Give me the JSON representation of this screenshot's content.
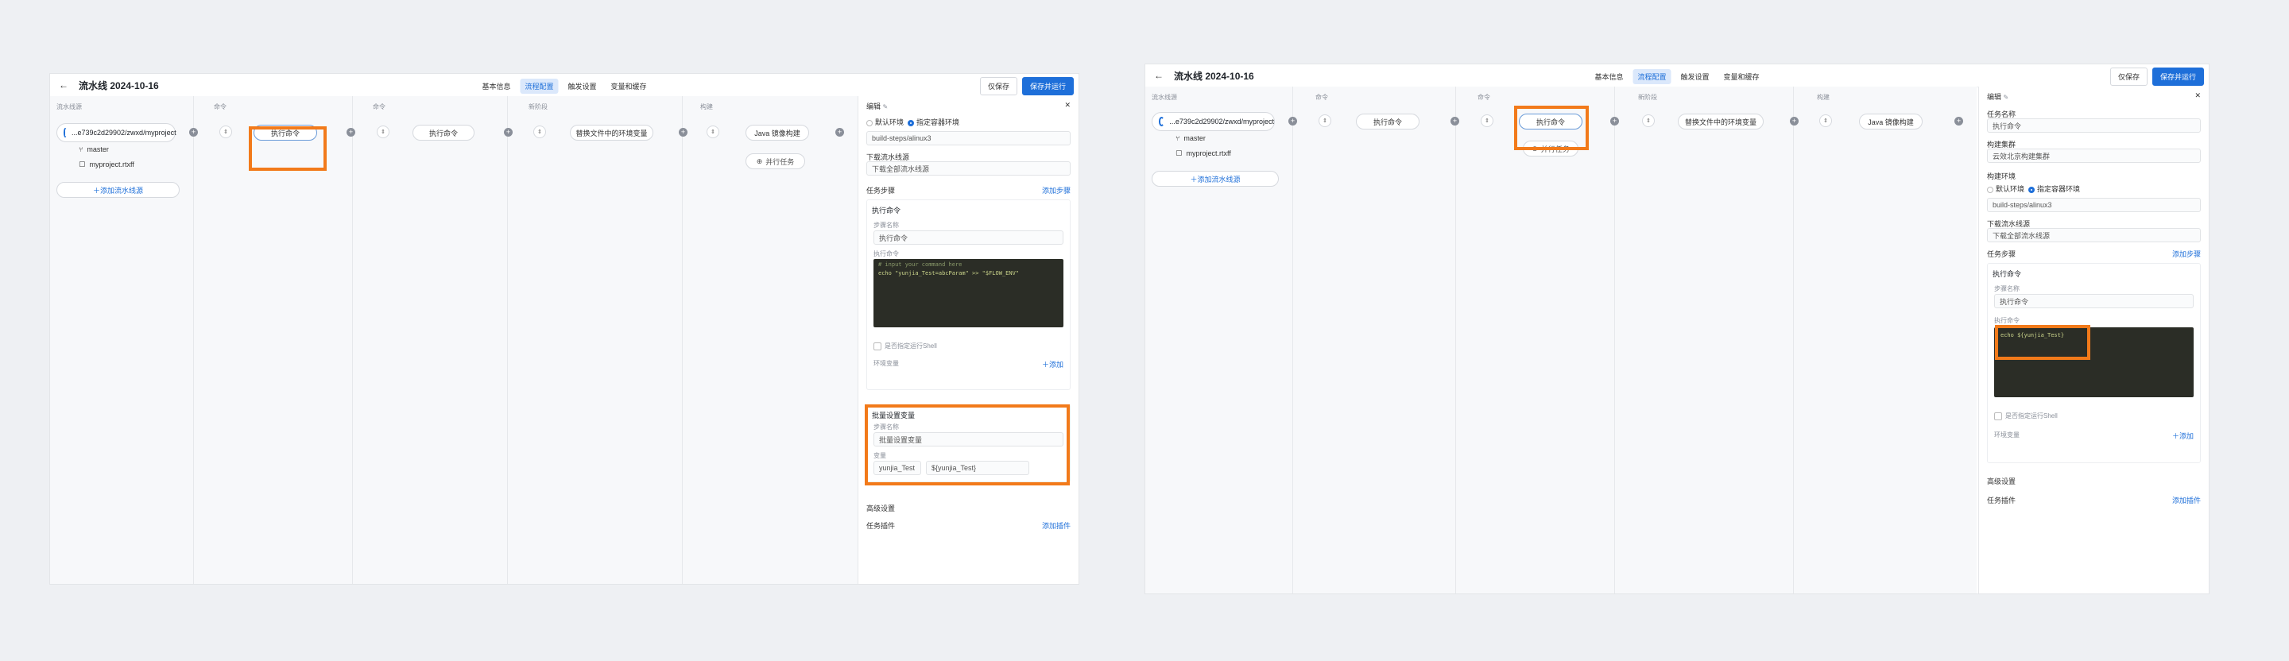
{
  "left": {
    "title": "流水线 2024-10-16",
    "tabs": [
      "基本信息",
      "流程配置",
      "触发设置",
      "变量和缓存"
    ],
    "save_label": "仅保存",
    "save_run_label": "保存并运行",
    "columns": [
      "流水线源",
      "命令",
      "命令",
      "新阶段",
      "构建"
    ],
    "source": {
      "repo": "...e739c2d29902/zwxd/myproject",
      "branch": "master",
      "file": "myproject.rtxff"
    },
    "add_pipeline_label": "添加流水线源",
    "nodes": [
      "执行命令",
      "执行命令",
      "替换文件中的环境变量",
      "Java 镜像构建"
    ],
    "parallel_label": "并行任务",
    "panel": {
      "title": "编辑",
      "env_default": "默认环境",
      "env_custom": "指定容器环境",
      "env_value": "build-steps/alinux3",
      "downstream_label": "下载流水线源",
      "downstream_value": "下载全部流水线源",
      "steps_label": "任务步骤",
      "add_step": "添加步骤",
      "step1_title": "执行命令",
      "step_name_label": "步骤名称",
      "step1_name": "执行命令",
      "cmd_label": "执行命令",
      "code_comment": "# input your command here",
      "code_line": "echo \"yunjia_Test=abcParam\" >> \"$FLOW_ENV\"",
      "shell_label": "是否指定运行Shell",
      "env_var_label": "环境变量",
      "add_label": "添加",
      "step2_title": "批量设置变量",
      "step2_name_label": "步骤名称",
      "step2_name": "批量设置变量",
      "var_label": "变量",
      "var_key": "yunjia_Test",
      "var_value": "${yunjia_Test}",
      "advanced_label": "高级设置",
      "plugin_label": "任务插件",
      "add_plugin": "添加插件"
    }
  },
  "right": {
    "title": "流水线 2024-10-16",
    "tabs": [
      "基本信息",
      "流程配置",
      "触发设置",
      "变量和缓存"
    ],
    "save_label": "仅保存",
    "save_run_label": "保存并运行",
    "columns": [
      "流水线源",
      "命令",
      "命令",
      "新阶段",
      "构建"
    ],
    "source": {
      "repo": "...e739c2d29902/zwxd/myproject",
      "branch": "master",
      "file": "myproject.rtxff"
    },
    "add_pipeline_label": "添加流水线源",
    "nodes": [
      "执行命令",
      "执行命令",
      "替换文件中的环境变量",
      "Java 镜像构建"
    ],
    "parallel_label": "并行任务",
    "panel": {
      "title": "编辑",
      "task_name_label": "任务名称",
      "task_name": "执行命令",
      "cluster_label": "构建集群",
      "cluster_value": "云效北京构建集群",
      "env_label": "构建环境",
      "env_default": "默认环境",
      "env_custom": "指定容器环境",
      "env_value": "build-steps/alinux3",
      "downstream_label": "下载流水线源",
      "downstream_value": "下载全部流水线源",
      "steps_label": "任务步骤",
      "add_step": "添加步骤",
      "step1_title": "执行命令",
      "step_name_label": "步骤名称",
      "step1_name": "执行命令",
      "cmd_label": "执行命令",
      "code_line": "echo ${yunjia_Test}",
      "shell_label": "是否指定运行Shell",
      "env_var_label": "环境变量",
      "add_label": "添加",
      "advanced_label": "高级设置",
      "plugin_label": "任务插件",
      "add_plugin": "添加插件"
    }
  }
}
